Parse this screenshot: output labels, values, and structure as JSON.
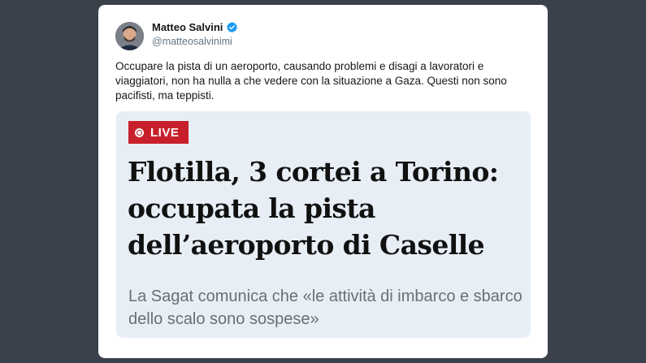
{
  "tweet": {
    "author_name": "Matteo Salvini",
    "author_handle": "@matteosalvinimi",
    "verified": true,
    "text": "Occupare la pista di un aeroporto, causando problemi e disagi a lavoratori e viaggiatori, non ha nulla a che vedere con la situazione a Gaza. Questi non sono pacifisti, ma teppisti."
  },
  "article_preview": {
    "badge": "LIVE",
    "headline": "Flotilla, 3 cortei a Torino: occupata la pista dell’aeroporto di Caselle",
    "subheadline": "La Sagat comunica che «le attività di imbarco e sbarco dello scalo sono sospese»"
  },
  "colors": {
    "page_background": "#3b414b",
    "card_background": "#ffffff",
    "preview_background": "#e8eef6",
    "live_badge": "#c8202b",
    "verified_badge": "#1d9bf0"
  }
}
